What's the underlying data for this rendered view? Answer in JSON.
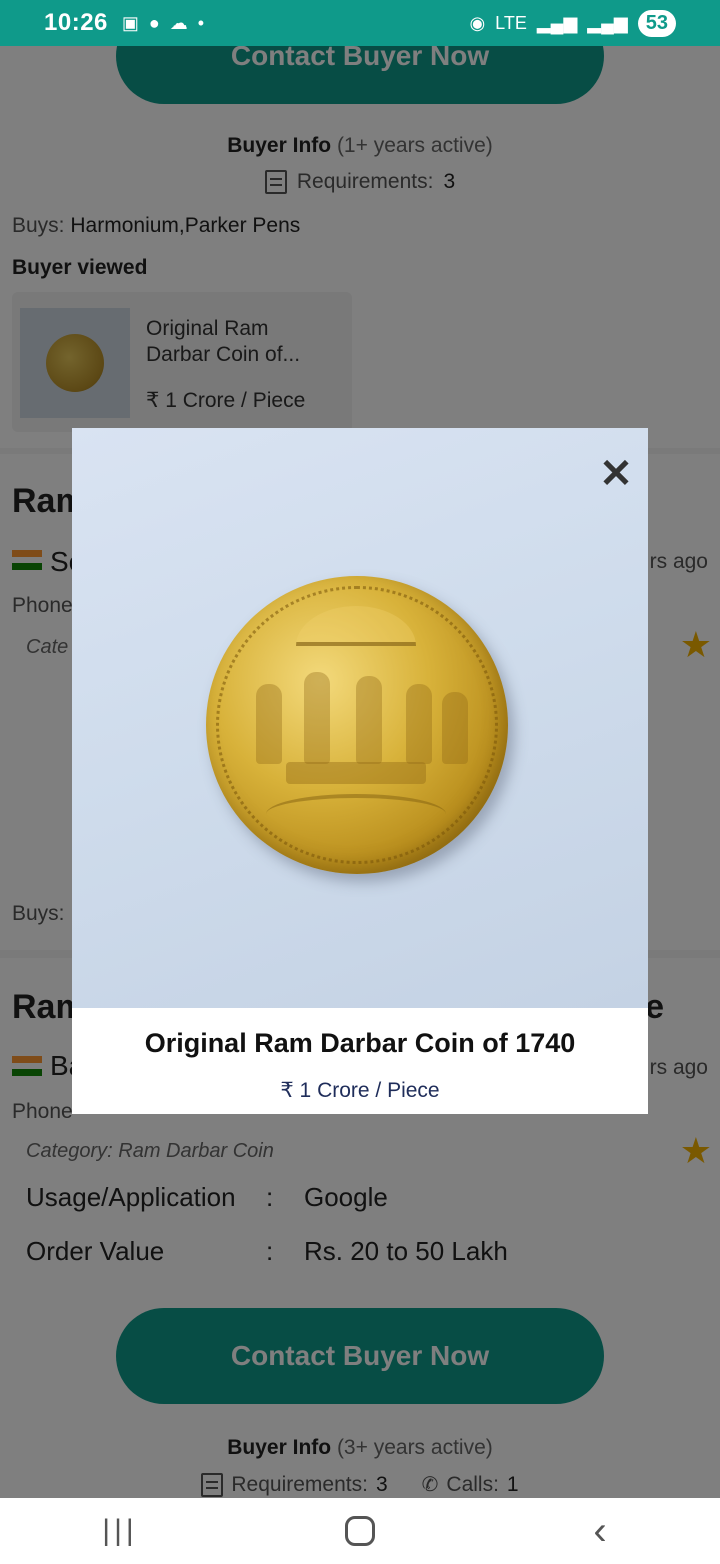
{
  "status_bar": {
    "time": "10:26",
    "network": "LTE",
    "battery": "53"
  },
  "top_card": {
    "cta_label": "Contact Buyer Now",
    "buyer_info_label": "Buyer Info",
    "buyer_info_active": "(1+ years active)",
    "requirements_label": "Requirements:",
    "requirements_value": "3",
    "buys_label": "Buys:",
    "buys_value": "Harmonium,Parker Pens",
    "buyer_viewed_label": "Buyer viewed",
    "viewed_item_title": "Original Ram Darbar Coin of...",
    "viewed_item_price": "₹ 1 Crore / Piece"
  },
  "card2": {
    "title_partial": "Ram",
    "seller_partial": "Se",
    "time_partial": "rs ago",
    "phone_partial": "Phone",
    "category_partial": "Cate",
    "buys_partial": "Buys:"
  },
  "card3": {
    "title_partial": "Ram",
    "title_end_partial": "e",
    "seller_partial": "Ba",
    "time_partial": "rs ago",
    "phone_partial": "Phone",
    "category": "Category: Ram Darbar Coin",
    "usage_label": "Usage/Application",
    "usage_value": "Google",
    "order_label": "Order Value",
    "order_value": "Rs. 20 to 50 Lakh",
    "separator": ":",
    "cta_label": "Contact Buyer Now",
    "buyer_info_label": "Buyer Info",
    "buyer_info_active": "(3+ years active)",
    "requirements_label": "Requirements:",
    "requirements_value": "3",
    "calls_label": "Calls:",
    "calls_value": "1"
  },
  "modal": {
    "title": "Original Ram Darbar Coin of 1740",
    "price": "₹ 1 Crore / Piece",
    "close_icon": "close-icon"
  },
  "colors": {
    "accent": "#0f9a8a",
    "star": "#f5b301"
  }
}
